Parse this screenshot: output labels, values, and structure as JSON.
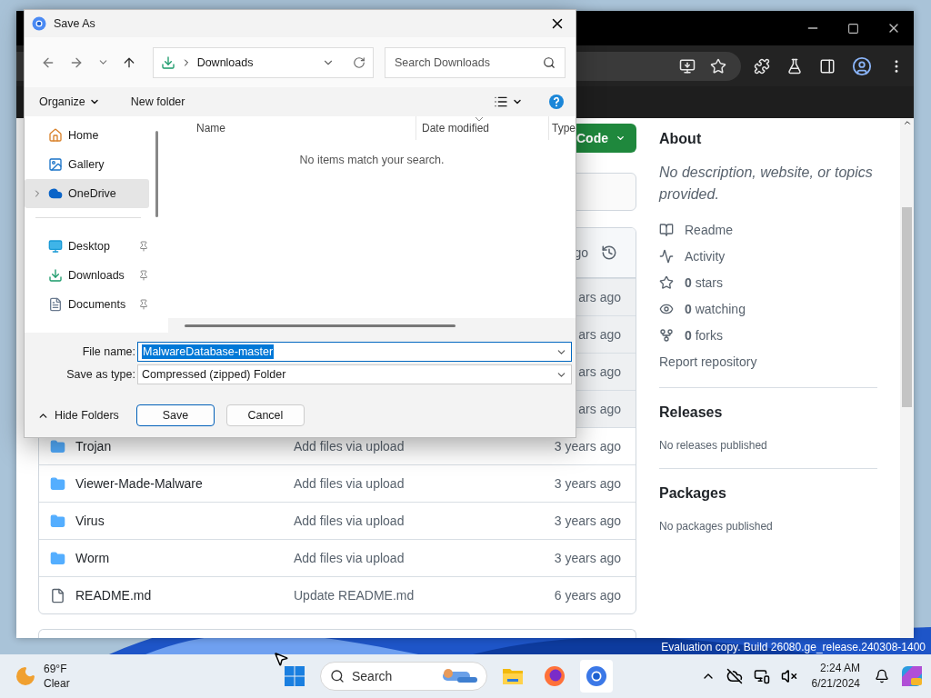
{
  "dialog": {
    "title": "Save As",
    "address": {
      "location": "Downloads"
    },
    "search": {
      "placeholder": "Search Downloads"
    },
    "commands": {
      "organize": "Organize",
      "new_folder": "New folder"
    },
    "nav_groups": [
      {
        "items": [
          {
            "kind": "home",
            "label": "Home",
            "selected": false,
            "pinned": false
          },
          {
            "kind": "gallery",
            "label": "Gallery",
            "selected": false,
            "pinned": false
          },
          {
            "kind": "cloud",
            "label": "OneDrive",
            "selected": true,
            "pinned": false
          }
        ]
      },
      {
        "items": [
          {
            "kind": "desktop",
            "label": "Desktop",
            "selected": false,
            "pinned": true
          },
          {
            "kind": "download",
            "label": "Downloads",
            "selected": false,
            "pinned": true
          },
          {
            "kind": "document",
            "label": "Documents",
            "selected": false,
            "pinned": true
          }
        ]
      }
    ],
    "columns": [
      {
        "label": "Name",
        "sorted": false
      },
      {
        "label": "Date modified",
        "sorted": true
      },
      {
        "label": "Type",
        "sorted": false
      }
    ],
    "empty_message": "No items match your search.",
    "file_name": {
      "label": "File name:",
      "value": "MalwareDatabase-master",
      "value_selected": true
    },
    "save_as_type": {
      "label": "Save as type:",
      "value": "Compressed (zipped) Folder"
    },
    "hide_folders": "Hide Folders",
    "buttons": [
      {
        "label": "Save",
        "default": true
      },
      {
        "label": "Cancel",
        "default": false
      }
    ]
  },
  "repo": {
    "code_button": "Code",
    "commit_header": {
      "time": "go"
    },
    "files": [
      {
        "kind": "hidden",
        "date": "ars ago"
      },
      {
        "kind": "hidden",
        "date": "ars ago"
      },
      {
        "kind": "hidden",
        "date": "ars ago"
      },
      {
        "kind": "hidden",
        "date": "ars ago"
      },
      {
        "kind": "folder",
        "name": "Trojan",
        "message": "Add files via upload",
        "date": "3 years ago"
      },
      {
        "kind": "folder",
        "name": "Viewer-Made-Malware",
        "message": "Add files via upload",
        "date": "3 years ago"
      },
      {
        "kind": "folder",
        "name": "Virus",
        "message": "Add files via upload",
        "date": "3 years ago"
      },
      {
        "kind": "folder",
        "name": "Worm",
        "message": "Add files via upload",
        "date": "3 years ago"
      },
      {
        "kind": "file",
        "name": "README.md",
        "message": "Update README.md",
        "date": "6 years ago"
      }
    ]
  },
  "about": {
    "title": "About",
    "description": "No description, website, or topics provided.",
    "links": [
      {
        "kind": "readme",
        "label": "Readme"
      },
      {
        "kind": "activity",
        "label": "Activity"
      },
      {
        "kind": "stars",
        "label": "**0** stars"
      },
      {
        "kind": "watching",
        "label": "**0** watching"
      },
      {
        "kind": "forks",
        "label": "**0** forks"
      }
    ],
    "report": "Report repository"
  },
  "releases": {
    "title": "Releases",
    "note": "No releases published"
  },
  "packages": {
    "title": "Packages",
    "note": "No packages published"
  },
  "desktop": {
    "notice": "Evaluation copy. Build 26080.ge_release.240308-1400"
  },
  "taskbar": {
    "weather": {
      "temp": "69°F",
      "condition": "Clear"
    },
    "search": "Search",
    "time": "2:24 AM",
    "date": "6/21/2024"
  }
}
